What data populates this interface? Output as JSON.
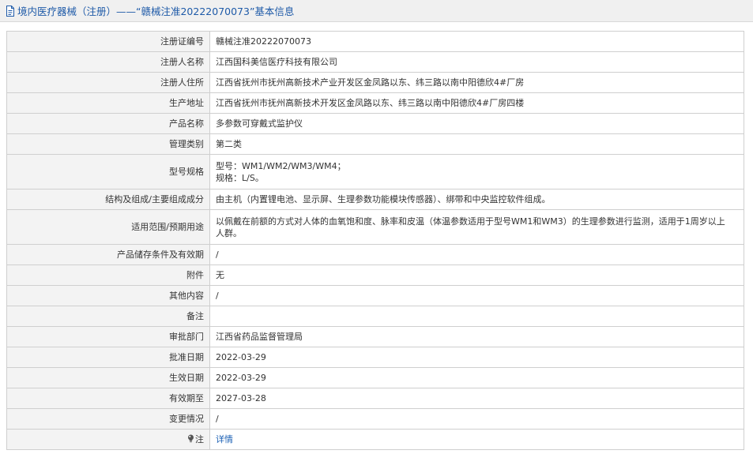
{
  "header": {
    "icon": "document-icon",
    "title": "境内医疗器械（注册）——“赣械注准20222070073”基本信息"
  },
  "rows": [
    {
      "key": "注册证编号",
      "value": "赣械注准20222070073"
    },
    {
      "key": "注册人名称",
      "value": "江西国科美信医疗科技有限公司"
    },
    {
      "key": "注册人住所",
      "value": "江西省抚州市抚州高新技术产业开发区金凤路以东、纬三路以南中阳德欣4#厂房"
    },
    {
      "key": "生产地址",
      "value": "江西省抚州市抚州高新技术开发区金凤路以东、纬三路以南中阳德欣4#厂房四楼"
    },
    {
      "key": "产品名称",
      "value": "多参数可穿戴式监护仪"
    },
    {
      "key": "管理类别",
      "value": "第二类"
    },
    {
      "key": "型号规格",
      "value_lines": [
        "型号：WM1/WM2/WM3/WM4；",
        "规格：L/S。"
      ]
    },
    {
      "key": "结构及组成/主要组成成分",
      "value": "由主机（内置锂电池、显示屏、生理参数功能模块传感器）、绑带和中央监控软件组成。"
    },
    {
      "key": "适用范围/预期用途",
      "value_lines": [
        "以佩戴在前额的方式对人体的血氧饱和度、脉率和皮温（体温参数适用于型号WM1和WM3）的生理参数进行监测，适用于1周岁以上",
        "人群。"
      ]
    },
    {
      "key": "产品储存条件及有效期",
      "value": "/"
    },
    {
      "key": "附件",
      "value": "无"
    },
    {
      "key": "其他内容",
      "value": "/"
    },
    {
      "key": "备注",
      "value": ""
    },
    {
      "key": "审批部门",
      "value": "江西省药品监督管理局"
    },
    {
      "key": "批准日期",
      "value": "2022-03-29"
    },
    {
      "key": "生效日期",
      "value": "2022-03-29"
    },
    {
      "key": "有效期至",
      "value": "2027-03-28"
    },
    {
      "key": "变更情况",
      "value": "/"
    },
    {
      "key": "注",
      "key_icon": "lightbulb-icon",
      "link": "详情"
    }
  ]
}
